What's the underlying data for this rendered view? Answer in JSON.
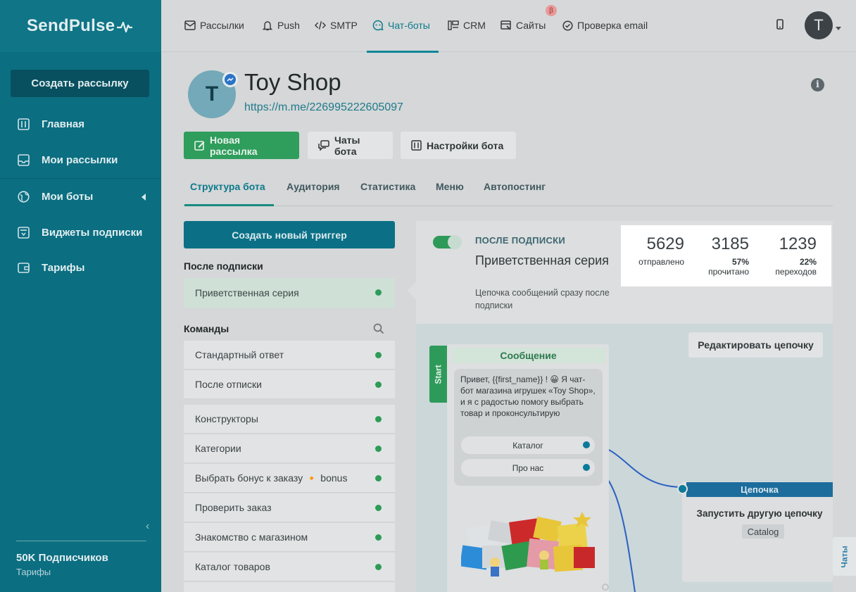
{
  "app": {
    "logo": "SendPulse"
  },
  "sidebar": {
    "create_label": "Создать рассылку",
    "items": [
      {
        "label": "Главная",
        "icon": "sliders-icon"
      },
      {
        "label": "Мои рассылки",
        "icon": "inbox-icon"
      },
      {
        "label": "Мои боты",
        "icon": "globe-icon"
      },
      {
        "label": "Виджеты подписки",
        "icon": "widget-icon"
      },
      {
        "label": "Тарифы",
        "icon": "wallet-icon"
      }
    ],
    "subscribers": "50K Подписчиков",
    "tariffs_link": "Тарифы"
  },
  "topnav": {
    "items": [
      {
        "label": "Рассылки",
        "icon": "mail-icon"
      },
      {
        "label": "Push",
        "icon": "bell-icon"
      },
      {
        "label": "SMTP",
        "icon": "code-icon"
      },
      {
        "label": "Чат-боты",
        "icon": "chatbot-icon"
      },
      {
        "label": "CRM",
        "icon": "crm-icon"
      },
      {
        "label": "Сайты",
        "icon": "site-icon"
      },
      {
        "label": "Проверка email",
        "icon": "check-icon"
      }
    ],
    "beta": "β",
    "avatar_letter": "T"
  },
  "bot": {
    "avatar_letter": "T",
    "name": "Toy Shop",
    "link": "https://m.me/226995222605097"
  },
  "actions": {
    "new_broadcast": "Новая рассылка",
    "bot_chats": "Чаты бота",
    "bot_settings": "Настройки бота"
  },
  "tabs": [
    "Структура бота",
    "Аудитория",
    "Статистика",
    "Меню",
    "Автопостинг"
  ],
  "left": {
    "create_trigger": "Создать новый триггер",
    "after_sub_header": "После подписки",
    "after_sub_items": [
      "Приветственная серия"
    ],
    "commands_header": "Команды",
    "commands": [
      "Стандартный ответ",
      "После отписки"
    ],
    "flows": [
      "Конструкторы",
      "Категории",
      "Выбрать бонус к заказу 🔸 bonus",
      "Проверить заказ",
      "Знакомство с магазином",
      "Каталог товаров"
    ]
  },
  "panel": {
    "label": "ПОСЛЕ ПОДПИСКИ",
    "title": "Приветственная серия",
    "description": "Цепочка сообщений сразу после подписки",
    "stats": [
      {
        "value": "5629",
        "label": "отправлено"
      },
      {
        "value": "3185",
        "pct": "57%",
        "label": "прочитано"
      },
      {
        "value": "1239",
        "pct": "22%",
        "label": "переходов"
      }
    ]
  },
  "canvas": {
    "edit_chain": "Редактировать цепочку",
    "start": "Start",
    "message_header": "Сообщение",
    "message_text": "Привет,  {{first_name}} ! 😀 Я чат-бот магазина игрушек «Toy Shop», и я с радостью помогу выбрать товар и проконсультирую",
    "buttons": [
      "Каталог",
      "Про нас"
    ],
    "chain_header": "Цепочка",
    "chain_title": "Запустить другую цепочку",
    "chain_tag": "Catalog",
    "chats_tab": "Чаты"
  }
}
